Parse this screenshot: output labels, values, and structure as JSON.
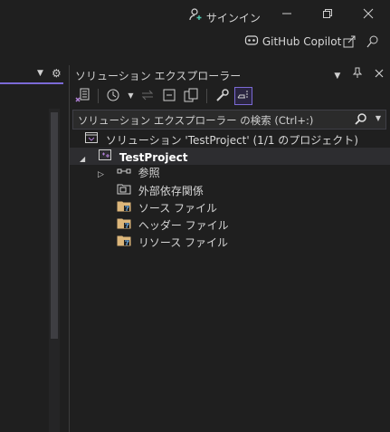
{
  "titlebar": {
    "signin_label": "サインイン",
    "copilot_label": "GitHub Copilot"
  },
  "panel": {
    "title": "ソリューション エクスプローラー",
    "search_placeholder": "ソリューション エクスプローラー の検索 (Ctrl+:)"
  },
  "tree": {
    "solution": "ソリューション 'TestProject' (1/1 のプロジェクト)",
    "project": "TestProject",
    "items": [
      "参照",
      "外部依存関係",
      "ソース ファイル",
      "ヘッダー ファイル",
      "リソース ファイル"
    ]
  },
  "colors": {
    "background": "#1f1f1f",
    "accent": "#7b6ad6",
    "selected_row": "#2d2d30",
    "folder": "#dcb67a"
  },
  "icons": [
    "account-add-icon",
    "minimize-icon",
    "restore-icon",
    "close-icon",
    "copilot-icon",
    "share-icon",
    "feedback-icon",
    "pin-icon",
    "gear-icon",
    "search-icon",
    "solution-icon",
    "project-icon",
    "references-icon",
    "folder-icon"
  ]
}
